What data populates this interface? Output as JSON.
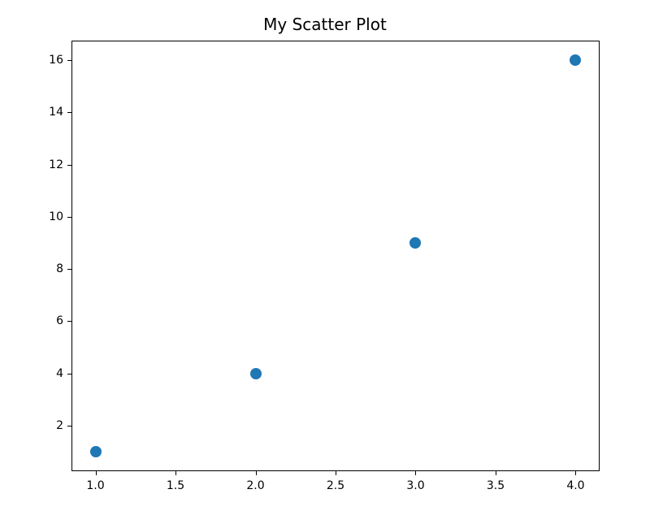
{
  "chart_data": {
    "type": "scatter",
    "title": "My Scatter Plot",
    "x": [
      1,
      2,
      3,
      4
    ],
    "y": [
      1,
      4,
      9,
      16
    ],
    "xlabel": "",
    "ylabel": "",
    "xlim": [
      0.85,
      4.15
    ],
    "ylim": [
      0.25,
      16.75
    ],
    "xticks": [
      1.0,
      1.5,
      2.0,
      2.5,
      3.0,
      3.5,
      4.0
    ],
    "yticks": [
      2,
      4,
      6,
      8,
      10,
      12,
      14,
      16
    ],
    "xtick_labels": [
      "1.0",
      "1.5",
      "2.0",
      "2.5",
      "3.0",
      "3.5",
      "4.0"
    ],
    "ytick_labels": [
      "2",
      "4",
      "6",
      "8",
      "10",
      "12",
      "14",
      "16"
    ],
    "marker_color": "#1f77b4"
  }
}
